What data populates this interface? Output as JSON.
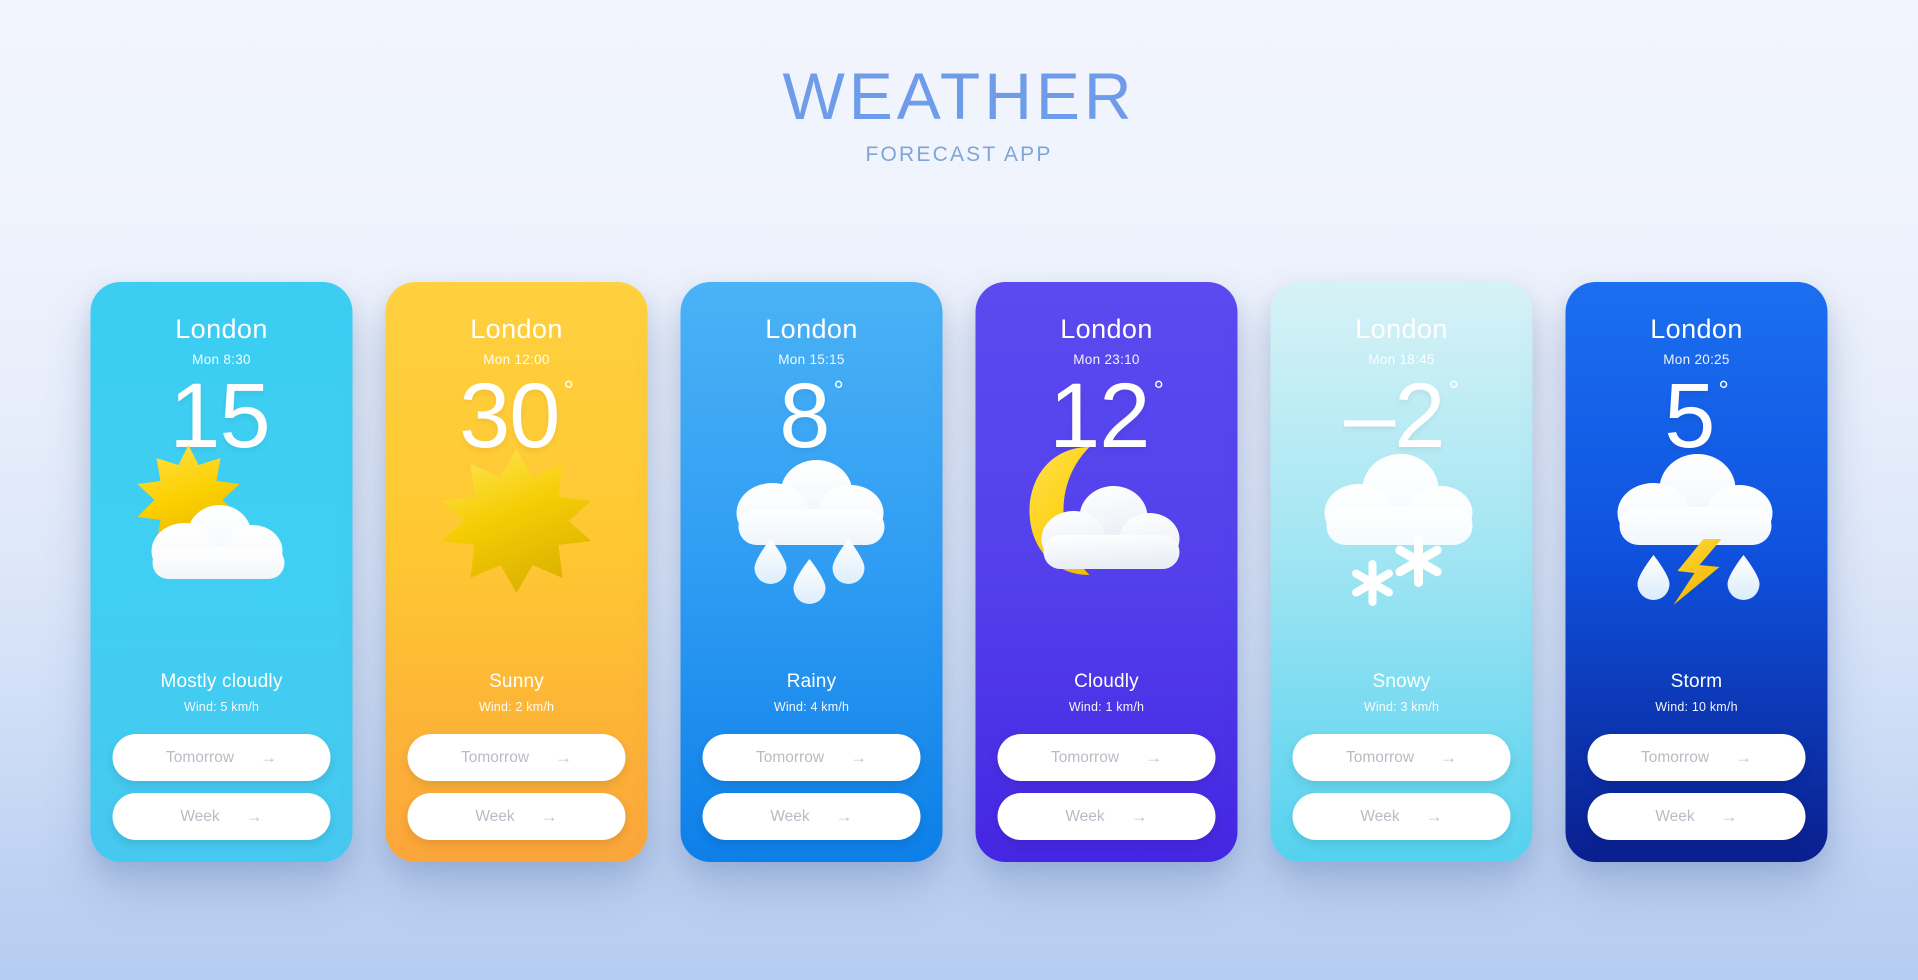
{
  "header": {
    "title": "WEATHER",
    "subtitle": "FORECAST APP",
    "title_color": "#6f9ce8",
    "subtitle_color": "#7fa5d8"
  },
  "buttons": {
    "tomorrow_label": "Tomorrow",
    "week_label": "Week",
    "arrow_icon": "→"
  },
  "cards": [
    {
      "city": "London",
      "datetime": "Mon 8:30",
      "temp": "15",
      "degree": "",
      "condition": "Mostly cloudly",
      "wind": "Wind: 5 km/h",
      "icon": "sun-behind-cloud-icon",
      "bg_color": "#3fcff2"
    },
    {
      "city": "London",
      "datetime": "Mon 12:00",
      "temp": "30",
      "degree": "°",
      "condition": "Sunny",
      "wind": "Wind: 2 km/h",
      "icon": "sun-icon",
      "bg_color": "#ffc832"
    },
    {
      "city": "London",
      "datetime": "Mon 15:15",
      "temp": "8",
      "degree": "°",
      "condition": "Rainy",
      "wind": "Wind: 4 km/h",
      "icon": "cloud-rain-icon",
      "bg_color": "#2f9cf3"
    },
    {
      "city": "London",
      "datetime": "Mon 23:10",
      "temp": "12",
      "degree": "°",
      "condition": "Cloudly",
      "wind": "Wind: 1 km/h",
      "icon": "moon-behind-cloud-icon",
      "bg_color": "#5340ec"
    },
    {
      "city": "London",
      "datetime": "Mon 18:45",
      "temp": "–2",
      "degree": "°",
      "condition": "Snowy",
      "wind": "Wind: 3 km/h",
      "icon": "cloud-snow-icon",
      "bg_color": "#a4e6f3"
    },
    {
      "city": "London",
      "datetime": "Mon 20:25",
      "temp": "5",
      "degree": "°",
      "condition": "Storm",
      "wind": "Wind: 10 km/h",
      "icon": "cloud-lightning-icon",
      "bg_color": "#0f53e0"
    }
  ]
}
